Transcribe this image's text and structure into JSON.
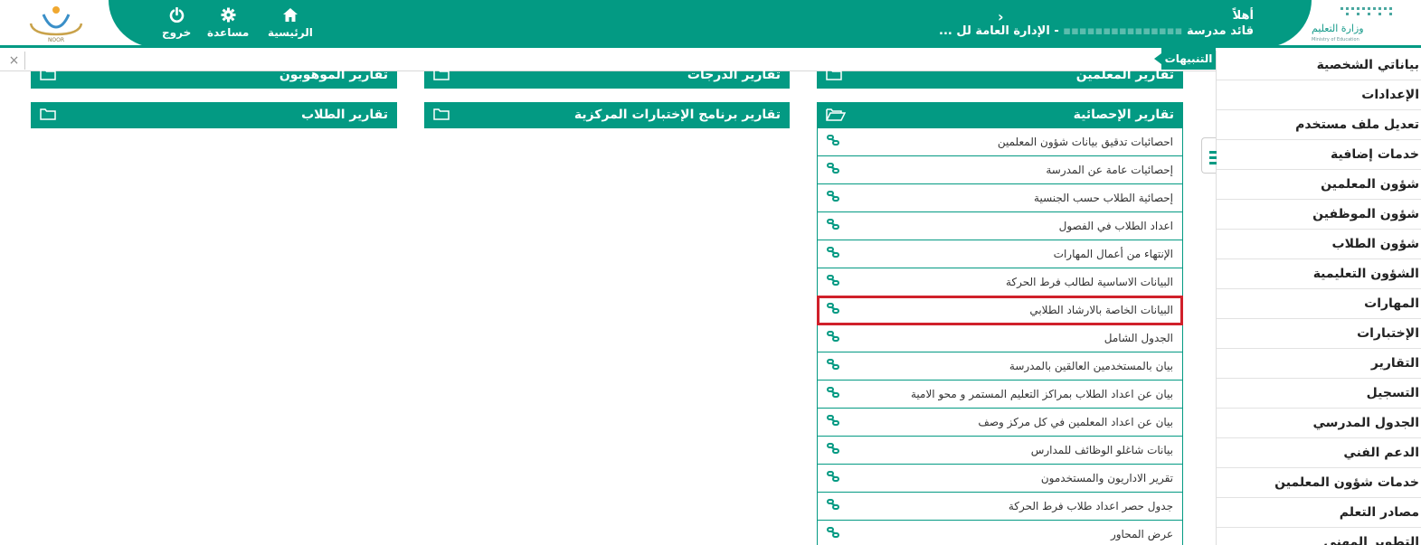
{
  "header": {
    "logo_text": "NOOR",
    "moe_logo_text": "وزارة التعليم",
    "moe_logo_subtext": "Ministry of Education",
    "nav": {
      "home_label": "الرئيسية",
      "help_label": "مساعدة",
      "logout_label": "خروج"
    },
    "greeting": "أهلاً",
    "role_line": "قائد مدرسة",
    "org_line": "- الإدارة العامة لل ...",
    "back_chevron": "›"
  },
  "alerts": {
    "tab_label": "التنبيهات",
    "close_symbol": "×"
  },
  "sidebar": {
    "items": [
      {
        "label": "بياناتي الشخصية"
      },
      {
        "label": "الإعدادات"
      },
      {
        "label": "تعديل ملف مستخدم"
      },
      {
        "label": "خدمات إضافية"
      },
      {
        "label": "شؤون المعلمين"
      },
      {
        "label": "شؤون الموظفين"
      },
      {
        "label": "شؤون الطلاب"
      },
      {
        "label": "الشؤون التعليمية"
      },
      {
        "label": "المهارات"
      },
      {
        "label": "الإختبارات"
      },
      {
        "label": "التقارير"
      },
      {
        "label": "التسجيل"
      },
      {
        "label": "الجدول المدرسي"
      },
      {
        "label": "الدعم الفني"
      },
      {
        "label": "خدمات شؤون المعلمين"
      },
      {
        "label": "مصادر التعلم"
      },
      {
        "label": "التطوير المهني"
      }
    ]
  },
  "panels": {
    "teachers_reports": "تقارير المعلمين",
    "grades_reports": "تقارير الدرجات",
    "gifted_reports": "تقارير الموهوبون",
    "statistical_reports": "تقارير الإحصائية",
    "central_exams_reports": "تقارير برنامج الإختبارات المركزية",
    "students_reports": "تقارير الطلاب"
  },
  "statistical_reports": [
    {
      "label": "احصائيات تدقيق بيانات شؤون المعلمين"
    },
    {
      "label": "إحصائيات عامة عن المدرسة"
    },
    {
      "label": "إحصائية الطلاب حسب الجنسية"
    },
    {
      "label": "اعداد الطلاب في الفصول"
    },
    {
      "label": "الإنتهاء من أعمال المهارات"
    },
    {
      "label": "البيانات الاساسية لطالب فرط الحركة"
    },
    {
      "label": "البيانات الخاصة بالارشاد الطلابي"
    },
    {
      "label": "الجدول الشامل"
    },
    {
      "label": "بيان بالمستخدمين العالقين بالمدرسة"
    },
    {
      "label": "بيان عن اعداد الطلاب بمراكز التعليم المستمر و محو الامية"
    },
    {
      "label": "بيان عن اعداد المعلمين في كل مركز وصف"
    },
    {
      "label": "بيانات شاغلو الوظائف للمدارس"
    },
    {
      "label": "تقرير الاداريون والمستخدمون"
    },
    {
      "label": "جدول حصر اعداد طلاب فرط الحركة"
    },
    {
      "label": "عرض المحاور"
    }
  ],
  "highlighted_report": "البيانات الخاصة بالارشاد الطلابي",
  "colors": {
    "brand": "#039a83",
    "highlight": "#d0202a"
  }
}
